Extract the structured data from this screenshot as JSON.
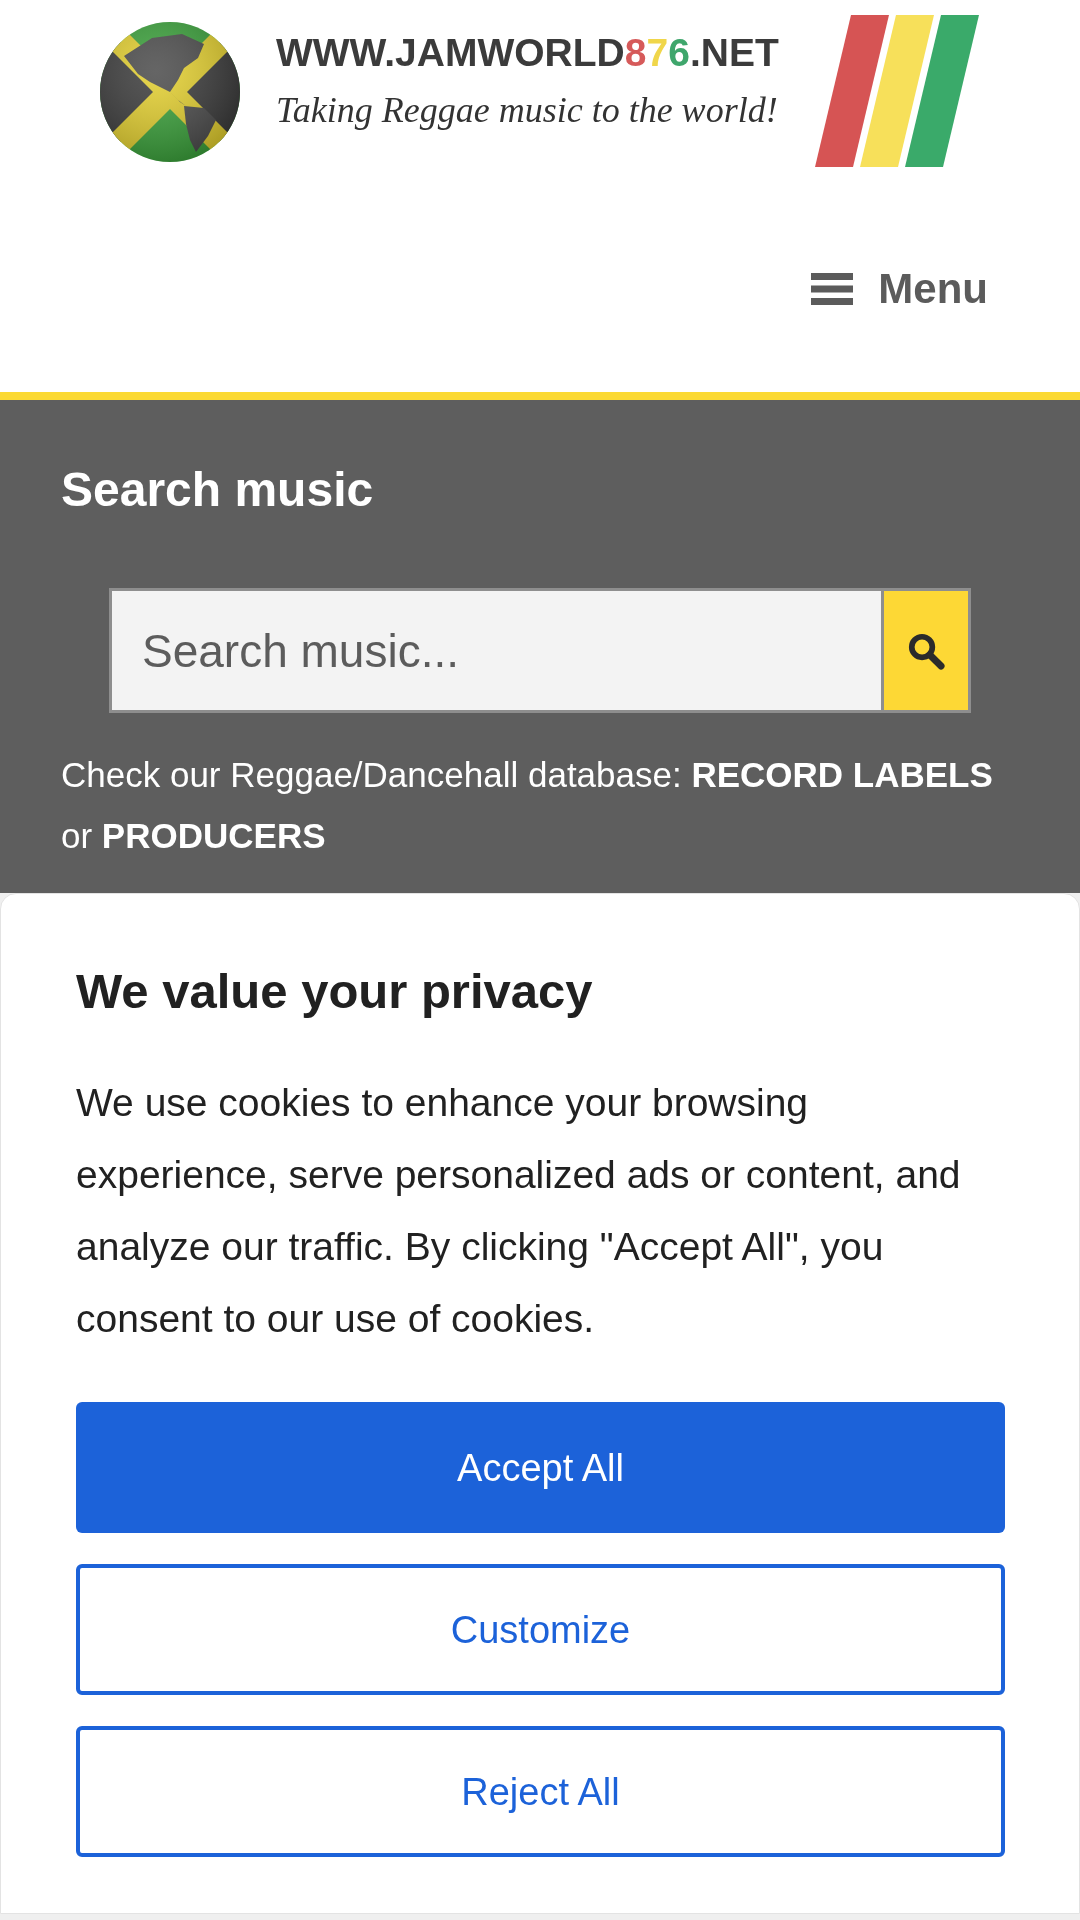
{
  "header": {
    "logo": {
      "wordmark": [
        {
          "text": "WWW.JAMWORLD",
          "color": "#3b3b3b"
        },
        {
          "text": "8",
          "color": "#d65a5a"
        },
        {
          "text": "7",
          "color": "#f0d64a"
        },
        {
          "text": "6",
          "color": "#3fa66c"
        },
        {
          "text": ".NET",
          "color": "#3b3b3b"
        }
      ],
      "tagline": "Taking Reggae music to the world!"
    },
    "menu_button": {
      "label": "Menu"
    }
  },
  "search_section": {
    "title": "Search music",
    "search": {
      "placeholder": "Search music..."
    },
    "note": [
      {
        "kind": "text",
        "text": "Check our Reggae/Dancehall database:"
      },
      {
        "kind": "link",
        "text": "RECORD LABELS"
      },
      {
        "kind": "text",
        "text": "or"
      },
      {
        "kind": "link",
        "text": "PRODUCERS"
      }
    ]
  },
  "cookie_banner": {
    "title": "We value your privacy",
    "message": "We use cookies to enhance your browsing experience, serve personalized ads or content, and analyze our traffic. By clicking \"Accept All\", you consent to our use of cookies.",
    "buttons": [
      {
        "label": "Accept All",
        "kind": "primary"
      },
      {
        "label": "Customize",
        "kind": "outline"
      },
      {
        "label": "Reject All",
        "kind": "outline"
      }
    ]
  }
}
